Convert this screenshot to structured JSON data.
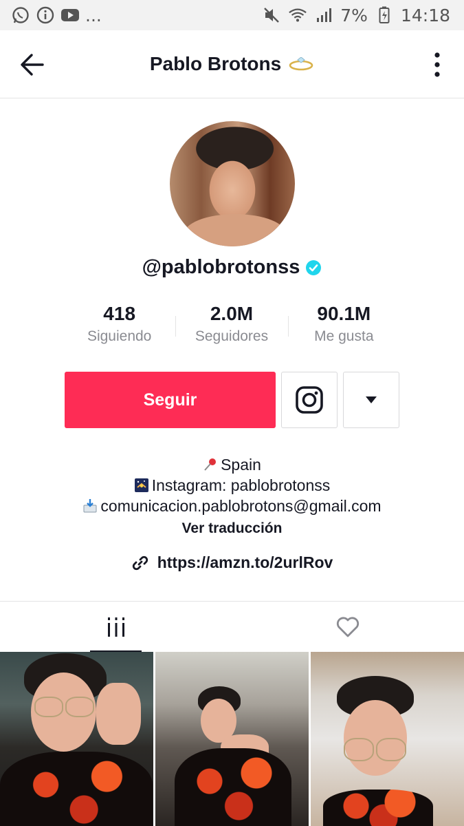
{
  "status_bar": {
    "left_more": "...",
    "battery": "7%",
    "time": "14:18"
  },
  "header": {
    "title": "Pablo Brotons"
  },
  "profile": {
    "username": "@pablobrotonss",
    "stats": [
      {
        "value": "418",
        "label": "Siguiendo"
      },
      {
        "value": "2.0M",
        "label": "Seguidores"
      },
      {
        "value": "90.1M",
        "label": "Me gusta"
      }
    ],
    "follow_label": "Seguir"
  },
  "bio": {
    "location": "Spain",
    "instagram": "Instagram: pablobrotonss",
    "email": "comunicacion.pablobrotons@gmail.com",
    "translate_label": "Ver traducción",
    "link": "https://amzn.to/2urlRov"
  },
  "icons": {
    "back": "arrow-left-icon",
    "more": "vertical-dots-icon",
    "instagram": "instagram-icon",
    "dropdown": "caret-down-icon",
    "grid_tab": "grid-icon",
    "liked_tab": "heart-icon",
    "link": "link-icon"
  },
  "colors": {
    "accent": "#fe2c55",
    "verified": "#20d5ec",
    "text": "#161823",
    "muted": "#8a8b91"
  }
}
